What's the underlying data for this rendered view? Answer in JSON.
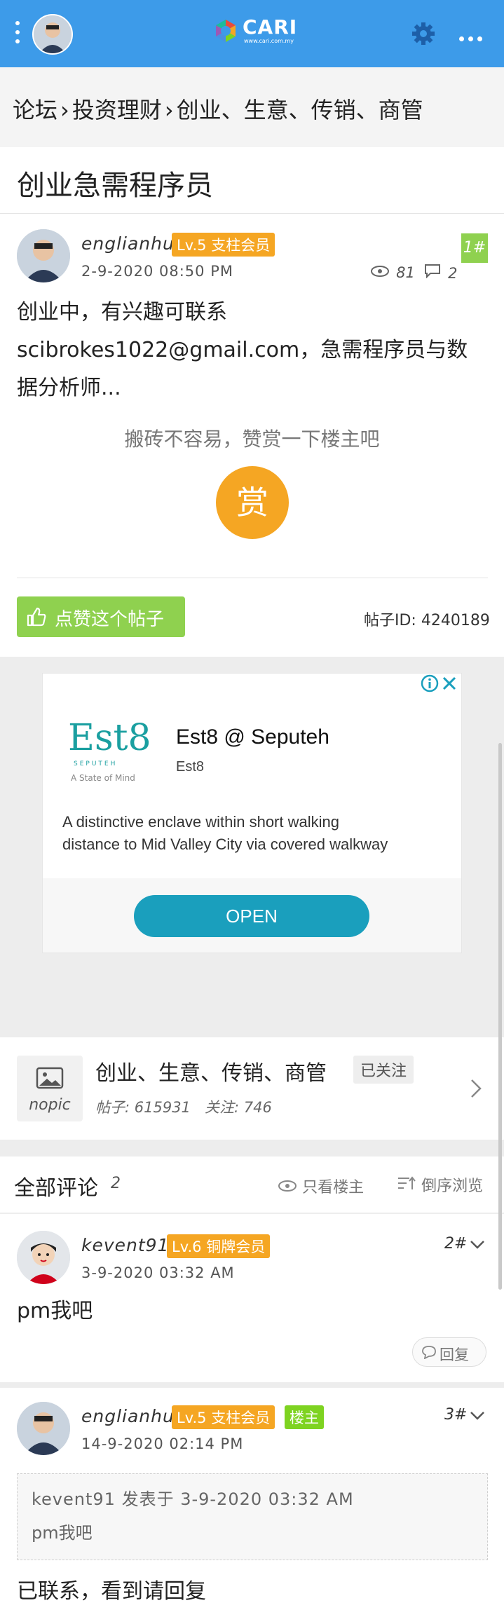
{
  "header": {
    "logo_text": "CARI",
    "logo_sub": "www.cari.com.my",
    "colors": {
      "bar": "#3d9be9",
      "accent": "#f5a623",
      "green": "#8fd14f"
    }
  },
  "breadcrumb": [
    "论坛",
    "投资理财",
    "创业、生意、传销、商管"
  ],
  "thread": {
    "title": "创业急需程序员",
    "author": "englianhu",
    "level": "Lv.5 支柱会员",
    "date": "2-9-2020 08:50 PM",
    "views": "81",
    "replies": "2",
    "floor": "1#",
    "body_line1": "创业中，有兴趣可联系",
    "body_line2": "scibrokes1022@gmail.com，急需程序员与数",
    "body_line3": "据分析师...",
    "reward_tip": "搬砖不容易，赞赏一下楼主吧",
    "reward_btn": "赏",
    "like_btn": "点赞这个帖子",
    "post_id": "帖子ID: 4240189"
  },
  "ad": {
    "logo_text": "Est8",
    "logo_sub1": "SEPUTEH",
    "logo_sub2": "A State of Mind",
    "headline": "Est8 @ Seputeh",
    "advertiser": "Est8",
    "desc_line1": "A distinctive enclave within short walking",
    "desc_line2": "distance to Mid Valley City via covered walkway",
    "cta": "OPEN"
  },
  "forum": {
    "nopic": "nopic",
    "name": "创业、生意、传销、商管",
    "follow_state": "已关注",
    "posts": "帖子: 615931",
    "followers": "关注: 746"
  },
  "comments_header": {
    "title": "全部评论",
    "count": "2",
    "only_op": "只看楼主",
    "reverse": "倒序浏览"
  },
  "comments": [
    {
      "author": "kevent91",
      "level": "Lv.6 铜牌会员",
      "date": "3-9-2020 03:32 AM",
      "floor": "2#",
      "body": "pm我吧",
      "reply": "回复"
    },
    {
      "author": "englianhu",
      "level": "Lv.5 支柱会员",
      "op_badge": "楼主",
      "date": "14-9-2020 02:14 PM",
      "floor": "3#",
      "quote_head": "kevent91 发表于 3-9-2020 03:32 AM",
      "quote_body": "pm我吧",
      "body": "已联系，看到请回复"
    }
  ]
}
